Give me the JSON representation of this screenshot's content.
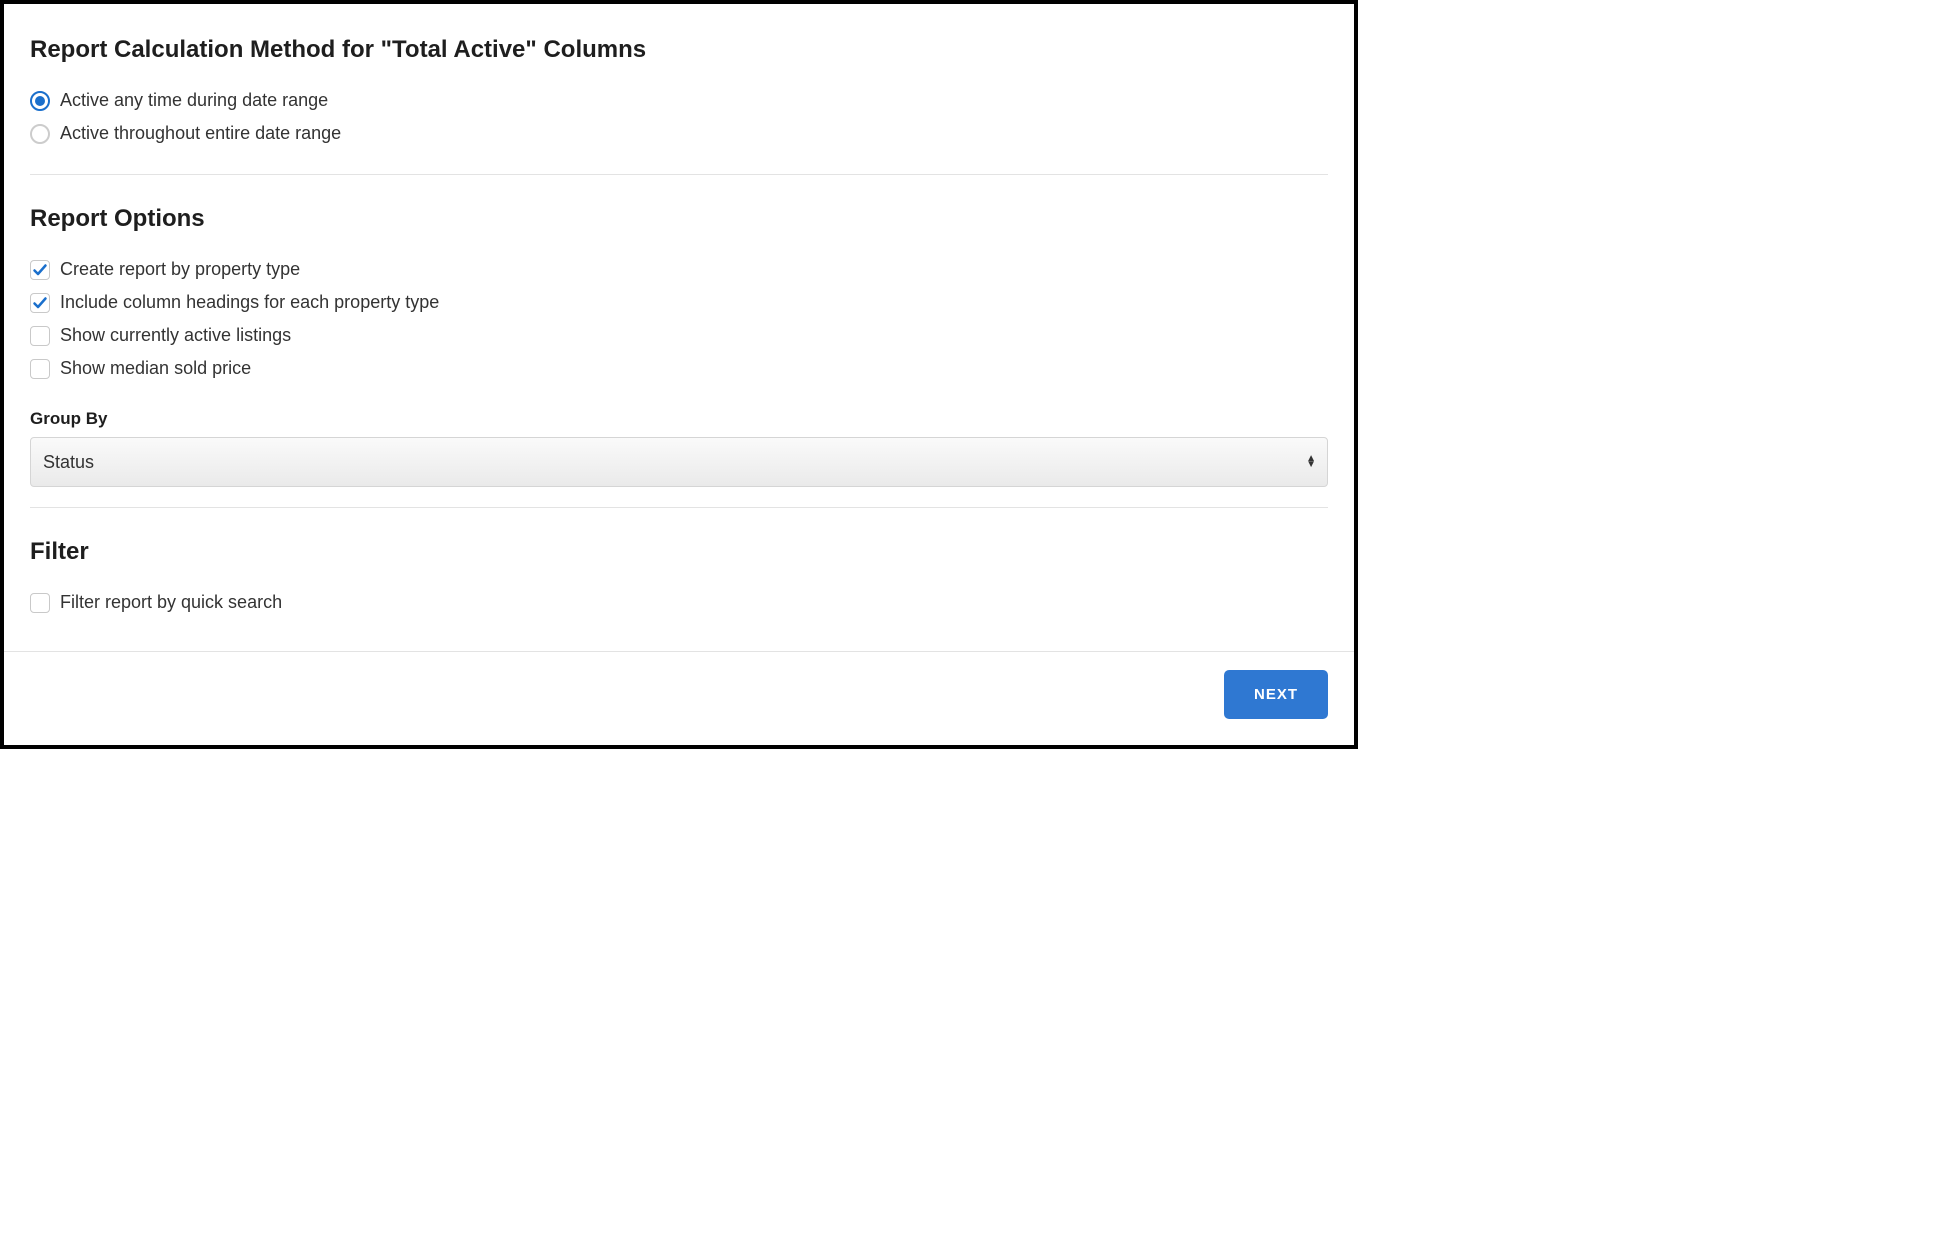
{
  "sections": {
    "calc_method": {
      "heading": "Report Calculation Method for \"Total Active\" Columns",
      "radios": {
        "any_time": {
          "label": "Active any time during date range",
          "checked": true
        },
        "throughout": {
          "label": "Active throughout entire date range",
          "checked": false
        }
      }
    },
    "report_options": {
      "heading": "Report Options",
      "checkboxes": {
        "by_property_type": {
          "label": "Create report by property type",
          "checked": true
        },
        "include_headings": {
          "label": "Include column headings for each property type",
          "checked": true
        },
        "show_active": {
          "label": "Show currently active listings",
          "checked": false
        },
        "show_median": {
          "label": "Show median sold price",
          "checked": false
        }
      },
      "group_by": {
        "label": "Group By",
        "value": "Status"
      }
    },
    "filter": {
      "heading": "Filter",
      "checkboxes": {
        "quick_search": {
          "label": "Filter report by quick search",
          "checked": false
        }
      }
    }
  },
  "footer": {
    "next_label": "NEXT"
  }
}
